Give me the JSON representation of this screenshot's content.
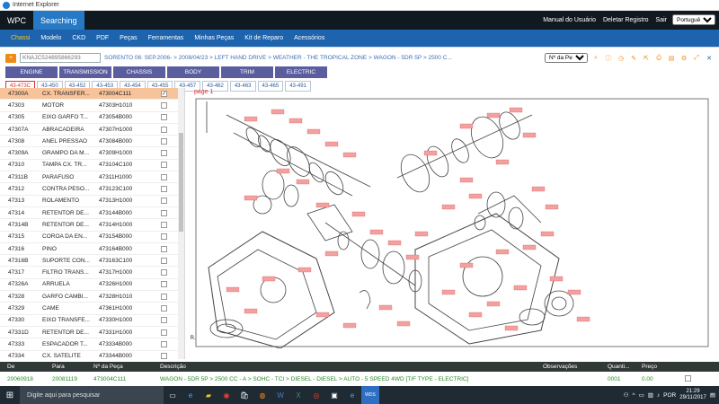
{
  "window": {
    "title": "Internet Explorer"
  },
  "topnav": {
    "brand": "WPC",
    "mode": "Searching",
    "links": [
      "Manual do Usuário",
      "Deletar Registro",
      "Sair"
    ],
    "language": "Português(E"
  },
  "menu": [
    "Chassi",
    "Modelo",
    "CKD",
    "PDF",
    "Peças",
    "Ferramentas",
    "Minhas Peças",
    "Kit de Reparo",
    "Acessórios"
  ],
  "search": {
    "vin_placeholder": "KNAJC524895866293",
    "breadcrumb": "SORENTO 06: SEP.2006- > 2008/04/23 > LEFT HAND DRIVE > WEATHER - THE TROPICAL ZONE > WAGON - 5DR 5P > 2500 C...",
    "select_label": "Nº da Peça"
  },
  "categories": [
    "ENGINE",
    "TRANSMISSION",
    "CHASSIS",
    "BODY",
    "TRIM",
    "ELECTRIC"
  ],
  "groups": [
    "43-473C",
    "43-450",
    "43-452",
    "43-453",
    "43-454",
    "43-455",
    "43-457",
    "43-462",
    "43-463",
    "43-465",
    "43-491"
  ],
  "page_label": "page 1",
  "parts": [
    {
      "ref": "47300A",
      "name": "CX. TRANSFER...",
      "num": "473004C111",
      "checked": true
    },
    {
      "ref": "47303",
      "name": "MOTOR",
      "num": "47303H1010",
      "checked": false
    },
    {
      "ref": "47305",
      "name": "EIXO GARFO T...",
      "num": "473054B000",
      "checked": false
    },
    {
      "ref": "47307A",
      "name": "ABRACADEIRA",
      "num": "47307H1000",
      "checked": false
    },
    {
      "ref": "47308",
      "name": "ANEL PRESSAO",
      "num": "473084B000",
      "checked": false
    },
    {
      "ref": "47309A",
      "name": "GRAMPO DA M...",
      "num": "47309H1000",
      "checked": false
    },
    {
      "ref": "47310",
      "name": "TAMPA CX. TR...",
      "num": "473104C100",
      "checked": false
    },
    {
      "ref": "47311B",
      "name": "PARAFUSO",
      "num": "47311H1000",
      "checked": false
    },
    {
      "ref": "47312",
      "name": "CONTRA PESO...",
      "num": "473123C100",
      "checked": false
    },
    {
      "ref": "47313",
      "name": "ROLAMENTO",
      "num": "47313H1000",
      "checked": false
    },
    {
      "ref": "47314",
      "name": "RETENTOR DE...",
      "num": "473144B000",
      "checked": false
    },
    {
      "ref": "47314B",
      "name": "RETENTOR DE...",
      "num": "47314H1000",
      "checked": false
    },
    {
      "ref": "47315",
      "name": "COROA DA EN...",
      "num": "473154B000",
      "checked": false
    },
    {
      "ref": "47316",
      "name": "PINO",
      "num": "473164B000",
      "checked": false
    },
    {
      "ref": "47316B",
      "name": "SUPORTE CON...",
      "num": "473163C100",
      "checked": false
    },
    {
      "ref": "47317",
      "name": "FILTRO TRANS...",
      "num": "47317H1000",
      "checked": false
    },
    {
      "ref": "47326A",
      "name": "ARRUELA",
      "num": "47326H1000",
      "checked": false
    },
    {
      "ref": "47328",
      "name": "GARFO CAMBI...",
      "num": "47328H1010",
      "checked": false
    },
    {
      "ref": "47329",
      "name": "CAME",
      "num": "47361H1000",
      "checked": false
    },
    {
      "ref": "47330",
      "name": "EIXO TRANSFE...",
      "num": "47330H1000",
      "checked": false
    },
    {
      "ref": "47331D",
      "name": "RETENTOR DE...",
      "num": "47331H1000",
      "checked": false
    },
    {
      "ref": "47333",
      "name": "ESPACADOR T...",
      "num": "473334B000",
      "checked": false
    },
    {
      "ref": "47334",
      "name": "CX. SATELITE",
      "num": "473344B000",
      "checked": false
    }
  ],
  "results": {
    "headers": [
      "De",
      "Para",
      "Nº da Peça",
      "Descrição",
      "Observações",
      "Quanti...",
      "Preço"
    ],
    "row": {
      "de": "20060918",
      "para": "20081119",
      "num": "473004C111",
      "desc": "WAGON - 5DR 5P > 2500 CC - A > SOHC - TCI > DIESEL - DIESEL > AUTO - 5 SPEED 4WD [T/F TYPE - ELECTRIC]",
      "qty": "0001",
      "price": "0.00"
    }
  },
  "taskbar": {
    "search_placeholder": "Digite aqui para pesquisar",
    "language": "POR",
    "time": "21:29",
    "date": "29/11/2017"
  },
  "colors": {
    "nav": "#101820",
    "menu": "#1e63ad",
    "accent": "#f08a16",
    "selected_row": "#f7c39a"
  }
}
